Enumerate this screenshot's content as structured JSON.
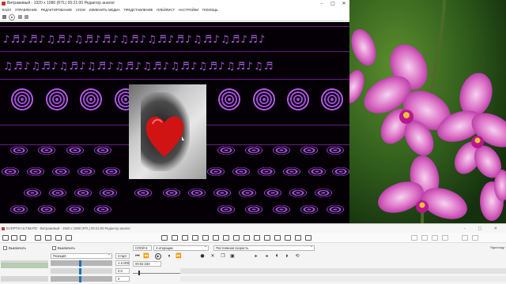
{
  "main_window": {
    "title": "Витраживый - 1920 x 1080 (RTL) 00:21:00 Редактор аналог",
    "controls": [
      "–",
      "□",
      "✕"
    ],
    "menu": [
      "ФАЙЛ",
      "УПРАВЛЕНИЕ",
      "РЕДАКТИРОВАНИЕ",
      "СЛОИ",
      "ИЗМЕНИТЬ МЕДИА",
      "ПРЕДСТАВЛЕНИЕ",
      "ПЛЕЙЛИСТ",
      "НАСТРОЙКИ",
      "ПОМОЩЬ"
    ]
  },
  "stage": {
    "notes_row_1": "♪♬♪♬♪♫♬♪♫♬♪♬♪♫♬♪♫♬♪♬♪♫♬♪♫♬♪♬♪",
    "notes_row_2": "♫♬♪♫♬♪♫♬♪♫♬♪♫♬♪♫♬♪♫♬♪♫♬♪♫♬♪♫♬",
    "accent_color": "#a14bd9",
    "heart_color": "#d01414"
  },
  "photo": {
    "subject": "orchid-flowers-photo"
  },
  "bottom_window": {
    "title": "EVDPTW ULTIMATE - Витраживый - 1920 x 1080 (RTL) 00:21:00 Редактор аналог",
    "controls": "– □ ✕",
    "checkbox_left_label": "Выключить",
    "checkbox_right_label": "Выключить",
    "dropdown_value": "Позиция",
    "field_1": "A 0.0000",
    "field_2": "0.0",
    "field_3": "0",
    "start_label": "Старт",
    "time_label": "00:02:333",
    "clip_label": "СЛОЙ 6",
    "clip_dropdown": "4 итерации",
    "speed_dropdown": "Постоянная скорость",
    "right_label": "Ядро/кадр"
  }
}
